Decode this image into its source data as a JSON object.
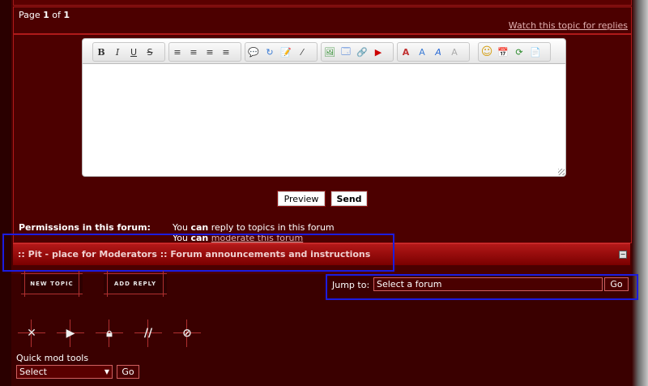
{
  "pagination": {
    "text_prefix": "Page ",
    "current": "1",
    "of": " of ",
    "total": "1"
  },
  "watch_link": "Watch this topic for replies",
  "toolbar": {
    "groups": [
      {
        "name": "format",
        "buttons": [
          "B",
          "I",
          "U",
          "S"
        ]
      },
      {
        "name": "align",
        "buttons": [
          "≡",
          "≡",
          "≡",
          "≡"
        ]
      },
      {
        "name": "misc",
        "buttons": [
          "💬",
          "↻",
          "📝",
          "⁄"
        ]
      },
      {
        "name": "media",
        "buttons": [
          "🖼",
          "🗔",
          "🔗",
          "▶"
        ]
      },
      {
        "name": "color",
        "buttons": [
          "A",
          "A",
          "A",
          "A"
        ]
      },
      {
        "name": "extra",
        "buttons": [
          "☺",
          "📅",
          "⟳",
          "📄"
        ]
      }
    ]
  },
  "buttons": {
    "preview": "Preview",
    "send": "Send"
  },
  "permissions": {
    "title": "Permissions in this forum:",
    "line1_prefix": "You ",
    "line1_bold": "can",
    "line1_suffix": " reply to topics in this forum",
    "line2_prefix": "You ",
    "line2_bold": "can",
    "line2_link": "moderate this forum"
  },
  "forum_breadcrumb": ":: Pit - place for Moderators :: Forum announcements and instructions",
  "actions": {
    "new_topic": "NEW TOPIC",
    "add_reply": "ADD REPLY"
  },
  "jump": {
    "label": "Jump to:",
    "value": "Select a forum",
    "go": "Go"
  },
  "mod_icons": [
    "delete-icon",
    "move-icon",
    "lock-icon",
    "split-icon",
    "merge-icon"
  ],
  "quick_mod": {
    "label": "Quick mod tools",
    "value": "Select",
    "go": "Go"
  },
  "colors": {
    "bg": "#3a0000",
    "panel": "#4c0000",
    "border": "#b01a1a",
    "highlight": "#1c1ce0"
  }
}
